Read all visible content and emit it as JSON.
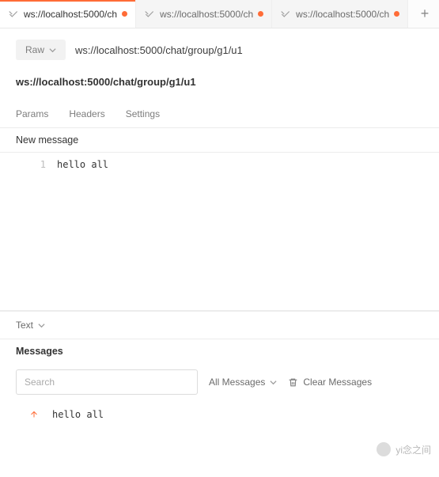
{
  "tabs": {
    "items": [
      {
        "label": "ws://localhost:5000/ch",
        "dirty": true
      },
      {
        "label": "ws://localhost:5000/ch",
        "dirty": true
      },
      {
        "label": "ws://localhost:5000/ch",
        "dirty": true
      }
    ]
  },
  "urlbar": {
    "raw_label": "Raw",
    "url": "ws://localhost:5000/chat/group/g1/u1"
  },
  "subtitle_url": "ws://localhost:5000/chat/group/g1/u1",
  "subtabs": {
    "params": "Params",
    "headers": "Headers",
    "settings": "Settings"
  },
  "editor": {
    "section_title": "New message",
    "line_number": "1",
    "content": "hello all"
  },
  "response": {
    "type_label": "Text",
    "messages_title": "Messages",
    "search_placeholder": "Search",
    "filter_label": "All Messages",
    "clear_label": "Clear Messages",
    "rows": [
      {
        "direction": "up",
        "text": "hello all"
      }
    ]
  },
  "watermark": "yi念之间",
  "colors": {
    "accent": "#ff6c37"
  }
}
